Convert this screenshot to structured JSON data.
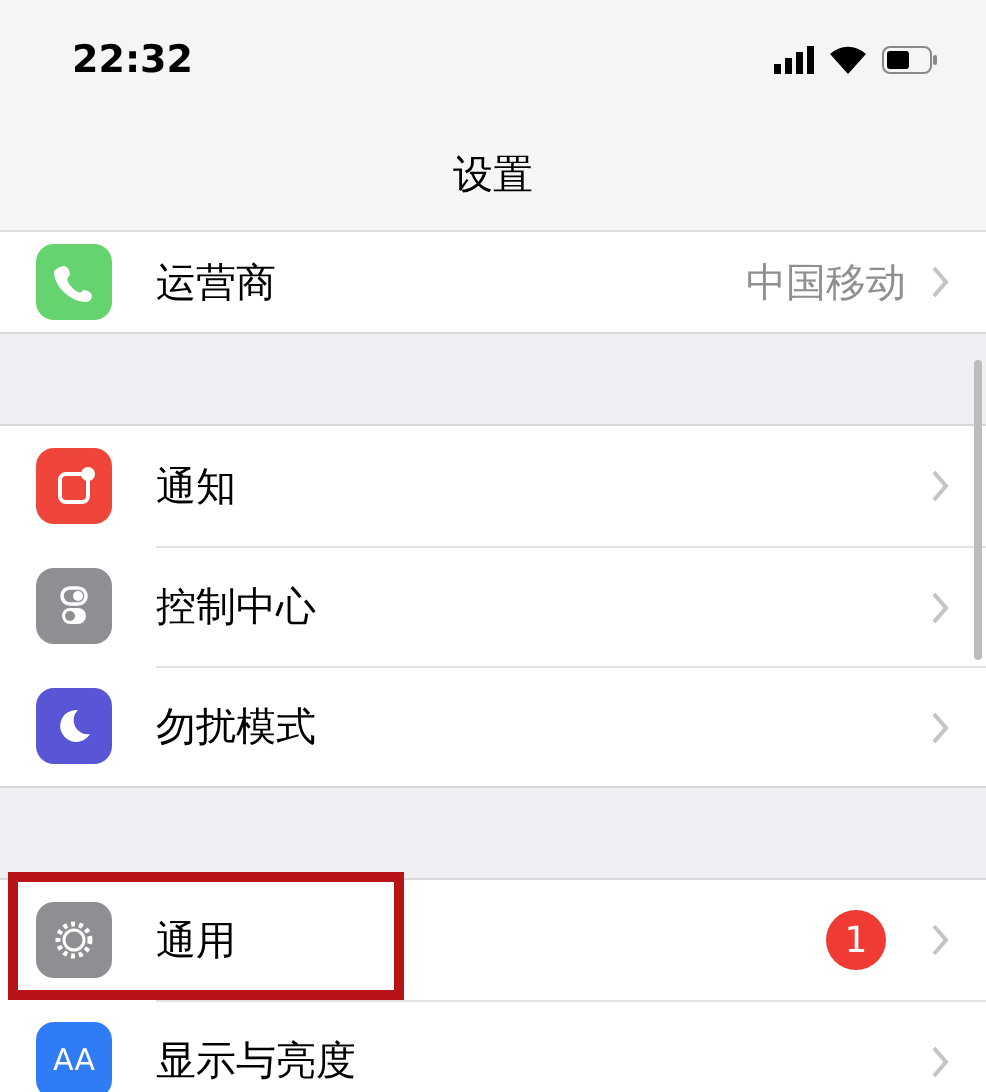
{
  "status_bar": {
    "time": "22:32"
  },
  "nav_bar": {
    "title": "设置"
  },
  "groups": [
    {
      "items": [
        {
          "kind": "phone",
          "label": "运营商",
          "value": "中国移动",
          "highlighted": false
        }
      ]
    },
    {
      "items": [
        {
          "kind": "notifications",
          "label": "通知",
          "highlighted": false
        },
        {
          "kind": "control-center",
          "label": "控制中心",
          "highlighted": false
        },
        {
          "kind": "do-not-disturb",
          "label": "勿扰模式",
          "highlighted": false
        }
      ]
    },
    {
      "items": [
        {
          "kind": "general",
          "label": "通用",
          "badge": "1",
          "highlighted": true
        },
        {
          "kind": "display",
          "label": "显示与亮度",
          "icon_text": "AA",
          "highlighted": false
        }
      ]
    }
  ]
}
